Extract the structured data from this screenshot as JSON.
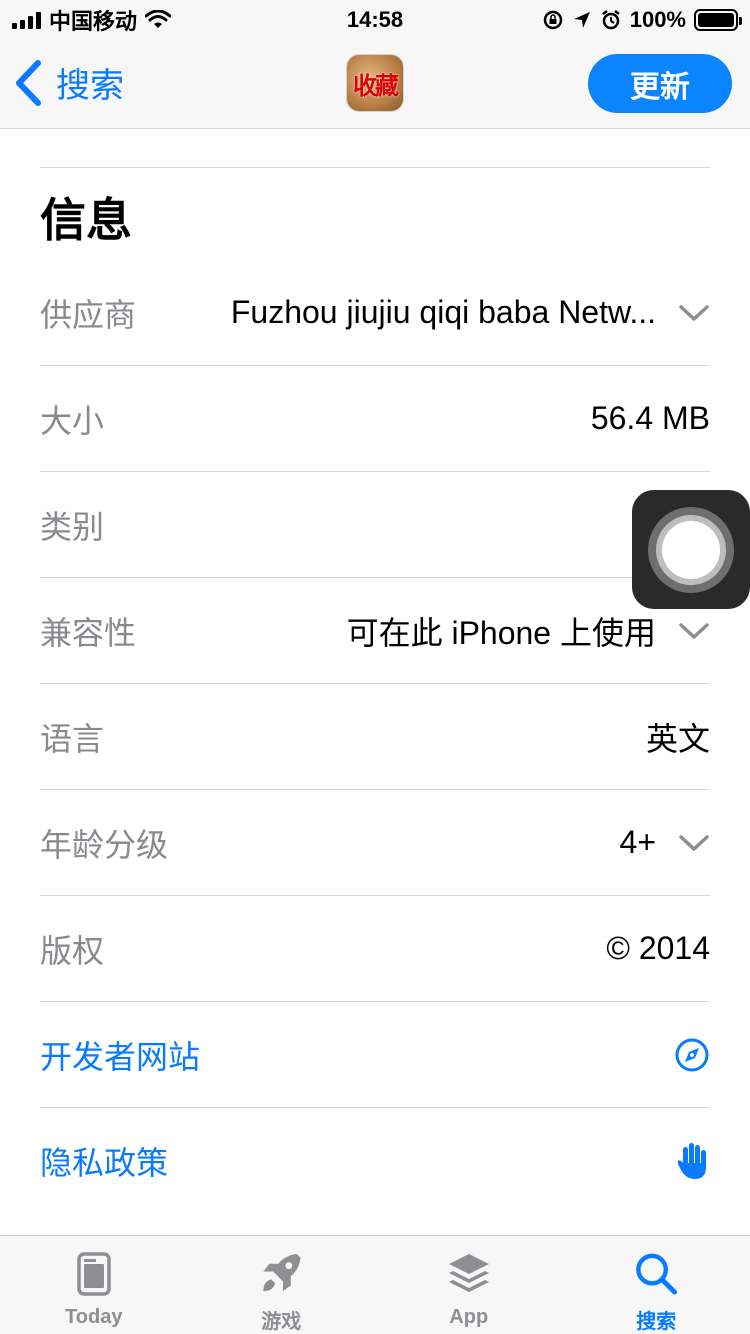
{
  "status_bar": {
    "carrier": "中国移动",
    "time": "14:58",
    "battery": "100%"
  },
  "nav": {
    "back_label": "搜索",
    "app_icon_text": "收藏",
    "update_label": "更新"
  },
  "section": {
    "title": "信息"
  },
  "info_rows": [
    {
      "label": "供应商",
      "value": "Fuzhou jiujiu qiqi baba Netw..."
    },
    {
      "label": "大小",
      "value": "56.4 MB"
    },
    {
      "label": "类别",
      "value": ""
    },
    {
      "label": "兼容性",
      "value": "可在此 iPhone 上使用"
    },
    {
      "label": "语言",
      "value": "英文"
    },
    {
      "label": "年龄分级",
      "value": "4+"
    },
    {
      "label": "版权",
      "value": "© 2014"
    }
  ],
  "links": [
    {
      "label": "开发者网站",
      "icon": "compass-icon"
    },
    {
      "label": "隐私政策",
      "icon": "hand-icon"
    }
  ],
  "tabs": [
    {
      "label": "Today",
      "icon": "today-icon"
    },
    {
      "label": "游戏",
      "icon": "rocket-icon"
    },
    {
      "label": "App",
      "icon": "layers-icon"
    },
    {
      "label": "搜索",
      "icon": "search-icon",
      "active": true
    }
  ],
  "colors": {
    "accent": "#0a7aff",
    "label_gray": "#8a8a8e"
  }
}
